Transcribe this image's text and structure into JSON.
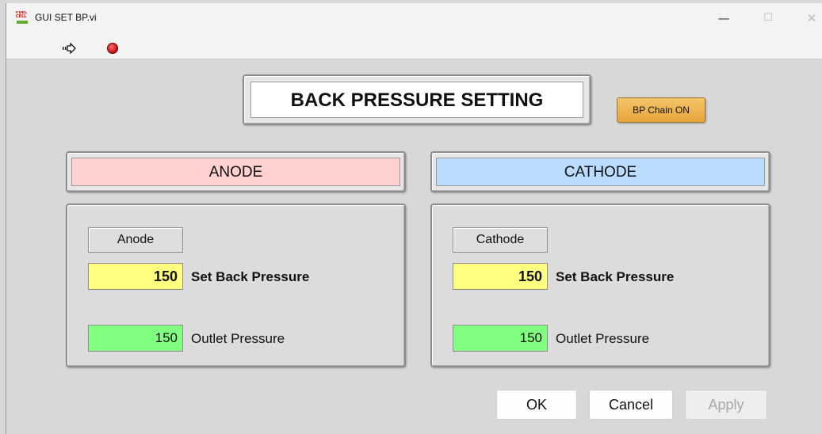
{
  "window": {
    "title": "GUI SET BP.vi",
    "app_icon_text": "FUEL CELL",
    "minimize_glyph": "—",
    "maximize_glyph": "☐",
    "close_glyph": "✕"
  },
  "toolbar": {
    "run_icon": "run-arrow-icon",
    "stop_icon": "abort-stop-icon"
  },
  "panel": {
    "title": "BACK PRESSURE SETTING",
    "chain_button_label": "BP Chain ON",
    "anode": {
      "header": "ANODE",
      "label": "Anode",
      "set_value": "150",
      "set_label": "Set Back Pressure",
      "outlet_value": "150",
      "outlet_label": "Outlet Pressure"
    },
    "cathode": {
      "header": "CATHODE",
      "label": "Cathode",
      "set_value": "150",
      "set_label": "Set Back Pressure",
      "outlet_value": "150",
      "outlet_label": "Outlet Pressure"
    }
  },
  "buttons": {
    "ok": "OK",
    "cancel": "Cancel",
    "apply": "Apply"
  },
  "colors": {
    "anode_header": "#ffd1d1",
    "cathode_header": "#b9dcff",
    "set_field": "#ffff80",
    "outlet_field": "#80ff80",
    "chain_button": "#e6a33a"
  }
}
